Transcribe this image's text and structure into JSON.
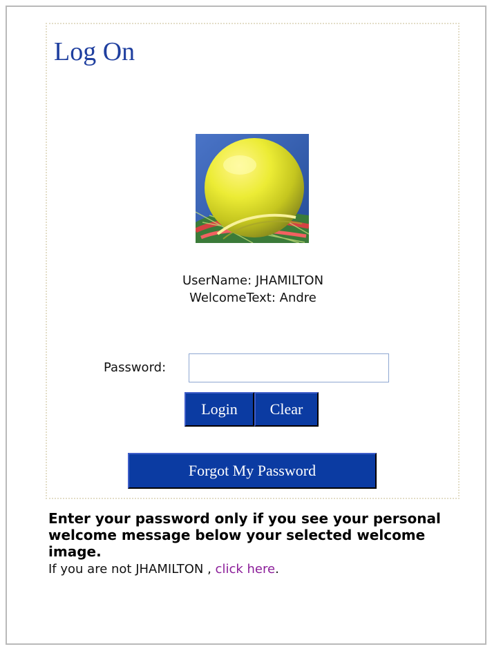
{
  "login": {
    "title": "Log On",
    "username_line": "UserName: JHAMILTON",
    "welcome_line": "WelcomeText: Andre",
    "password_label": "Password:",
    "password_value": "",
    "login_label": "Login",
    "clear_label": "Clear",
    "forgot_label": "Forgot My Password"
  },
  "instructions": {
    "text": "Enter your password only if you see your personal welcome message below your selected welcome image."
  },
  "not_user": {
    "prefix": "If you are not JHAMILTON ,",
    "link_text": "click here",
    "suffix": "."
  },
  "icons": {
    "welcome_image": "tennis-ball-icon"
  },
  "colors": {
    "title": "#1f3f9f",
    "button_background": "#0b3ba2",
    "link": "#8b1d99",
    "panel_border": "#e3ddc7"
  }
}
